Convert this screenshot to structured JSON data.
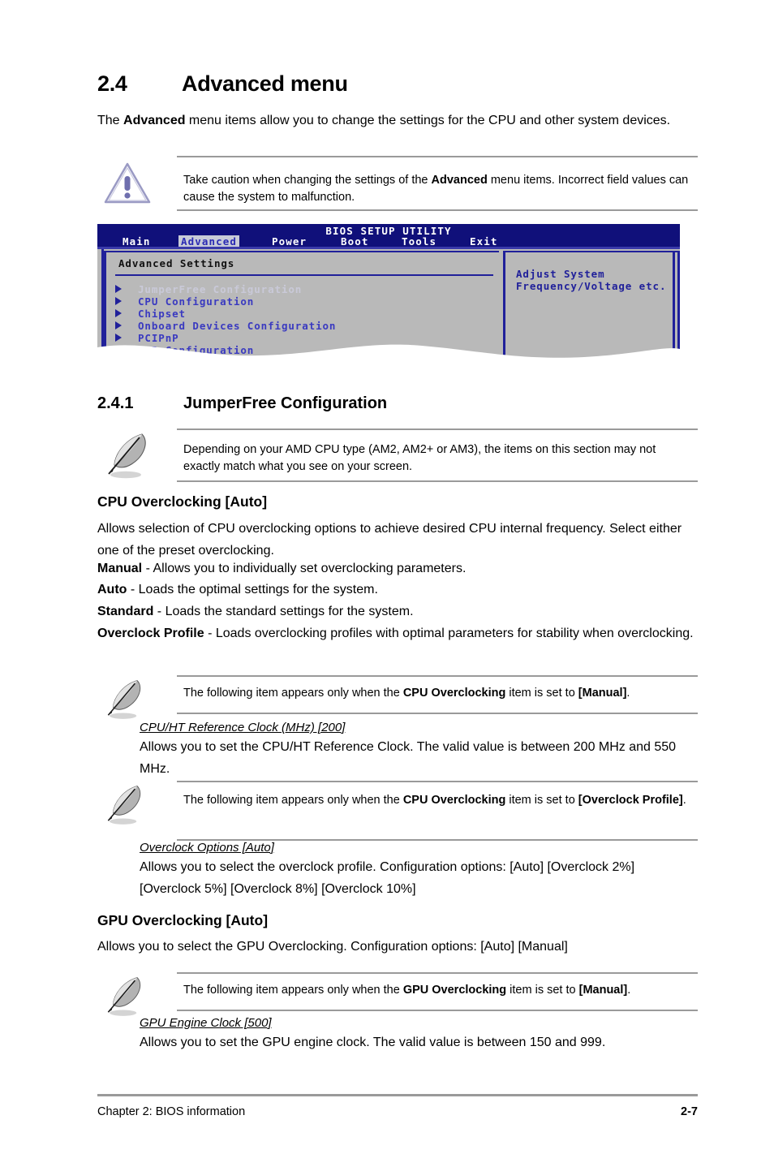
{
  "section": {
    "number": "2.4",
    "title": "Advanced menu",
    "intro_pre": "The ",
    "intro_bold": "Advanced",
    "intro_post": " menu items allow you to change the settings for the CPU and other system devices."
  },
  "caution": {
    "icon": "warning-triangle-icon",
    "text_pre": "Take caution when changing the settings of the ",
    "text_bold": "Advanced",
    "text_post": " menu items. Incorrect field values can cause the system to malfunction."
  },
  "bios": {
    "title": "BIOS SETUP UTILITY",
    "tabs": [
      {
        "label": "Main",
        "active": false
      },
      {
        "label": "Advanced",
        "active": true
      },
      {
        "label": "Power",
        "active": false
      },
      {
        "label": "Boot",
        "active": false
      },
      {
        "label": "Tools",
        "active": false
      },
      {
        "label": "Exit",
        "active": false
      }
    ],
    "panel_heading": "Advanced Settings",
    "menu_items": [
      "JumperFree Configuration",
      "CPU Configuration",
      "Chipset",
      "Onboard Devices Configuration",
      "PCIPnP",
      "USB Configuration"
    ],
    "help_line1": "Adjust System",
    "help_line2": "Frequency/Voltage etc.",
    "colors": {
      "header_bg": "#10107a",
      "panel_bg": "#b9b9b9",
      "border_blue": "#20209a",
      "menu_text": "#3a3ac0",
      "active_tab_bg": "#c8cbd8",
      "active_tab_text": "#2a2ab4"
    }
  },
  "subsection": {
    "number": "2.4.1",
    "title": "JumperFree Configuration"
  },
  "note_amd": {
    "icon": "quill-note-icon",
    "text": "Depending on your AMD CPU type (AM2, AM2+ or AM3), the items on this section may not exactly match what you see on your screen."
  },
  "cpu_oc": {
    "heading": "CPU Overclocking [Auto]",
    "desc": "Allows selection of CPU overclocking options to achieve desired CPU internal frequency. Select either one of the preset overclocking.",
    "options": [
      {
        "name": "Manual",
        "desc": " - Allows you to individually set overclocking parameters."
      },
      {
        "name": "Auto",
        "desc": " - Loads the optimal settings for the system."
      },
      {
        "name": "Standard",
        "desc": " - Loads the standard settings for the system."
      },
      {
        "name": "Overclock Profile",
        "desc": " - Loads overclocking profiles with optimal parameters for stability when overclocking."
      }
    ]
  },
  "note_manual": {
    "icon": "quill-note-icon",
    "pre": "The following item appears only when the ",
    "bold1": "CPU Overclocking",
    "mid": " item is set to ",
    "bold2": "[Manual]",
    "post": "."
  },
  "ref_clock": {
    "title": "CPU/HT Reference Clock (MHz) [200]",
    "desc": "Allows you to set the CPU/HT Reference Clock. The valid value is between 200 MHz and 550 MHz."
  },
  "note_profile": {
    "icon": "quill-note-icon",
    "pre": "The following item appears only when the ",
    "bold1": "CPU Overclocking",
    "mid": " item is set to ",
    "bold2": "[Overclock Profile]",
    "post": "."
  },
  "oc_options": {
    "title": "Overclock Options [Auto]",
    "desc": "Allows you to select the overclock profile. Configuration options: [Auto] [Overclock 2%] [Overclock 5%] [Overclock 8%] [Overclock 10%]"
  },
  "gpu_oc": {
    "heading": "GPU Overclocking [Auto]",
    "desc": "Allows you to select the GPU Overclocking. Configuration options: [Auto] [Manual]"
  },
  "note_gpu_manual": {
    "icon": "quill-note-icon",
    "pre": "The following item appears only when the ",
    "bold1": "GPU Overclocking",
    "mid": " item is set to ",
    "bold2": "[Manual]",
    "post": "."
  },
  "gpu_engine": {
    "title": "GPU Engine Clock [500]",
    "desc": "Allows you to set the GPU engine clock. The valid value is between 150 and 999."
  },
  "footer": {
    "left": "Chapter 2: BIOS information",
    "page": "2-7"
  }
}
